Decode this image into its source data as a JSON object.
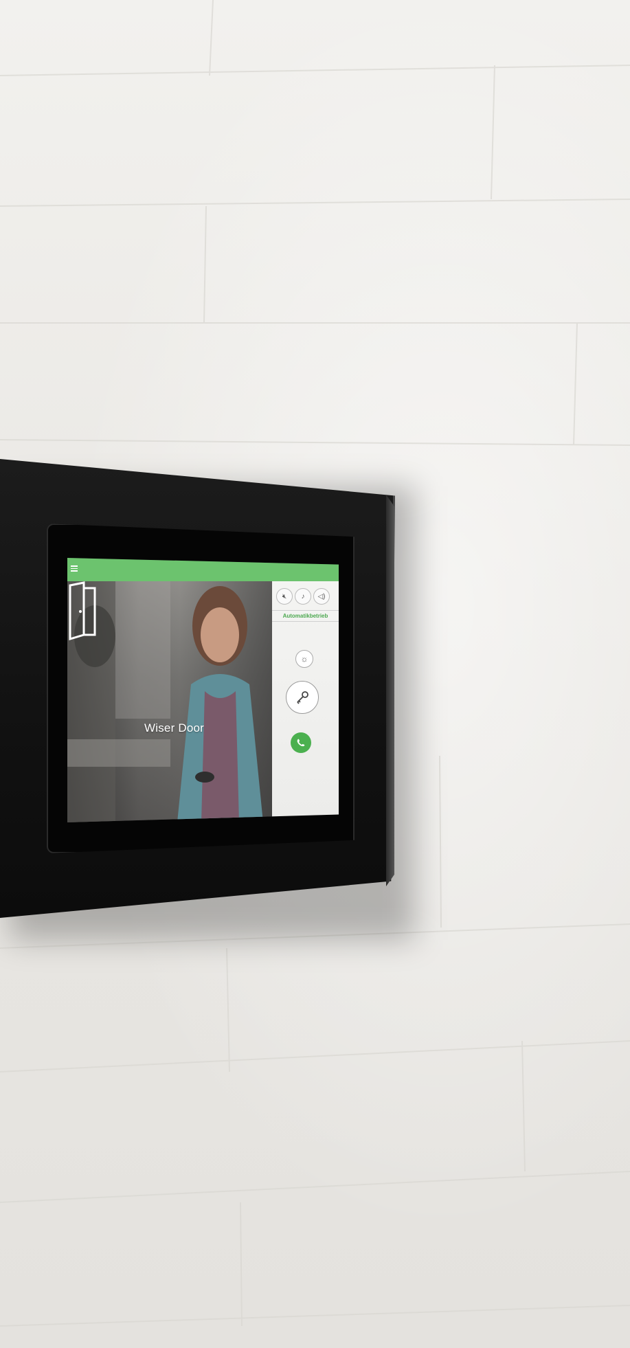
{
  "screen": {
    "door_title": "Wiser Door",
    "mode_label": "Automatikbetrieb",
    "accent_color": "#6cc36e",
    "icons": {
      "menu": "menu-icon",
      "home": "home-icon",
      "mute": "mute-icon",
      "bell": "bell-icon",
      "volume": "volume-icon",
      "light": "light-icon",
      "key": "key-icon",
      "call": "phone-icon"
    }
  }
}
